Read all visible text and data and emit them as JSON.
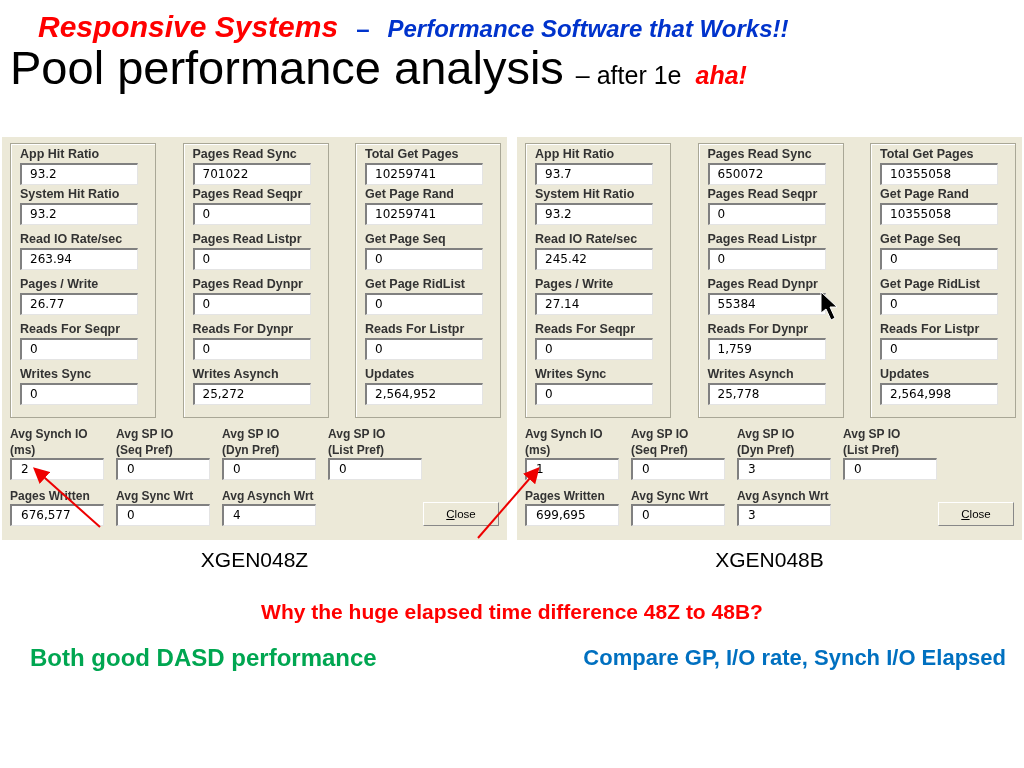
{
  "header": {
    "brand": "Responsive Systems",
    "dash": "–",
    "tagline": "Performance Software that Works!!"
  },
  "title": {
    "main": "Pool performance analysis",
    "suffix": "– after 1e",
    "exclaim": "aha!"
  },
  "panels": [
    {
      "caption": "XGEN048Z",
      "groups": [
        [
          {
            "label": "App Hit Ratio",
            "value": "93.2"
          },
          {
            "label": "System Hit Ratio",
            "value": "93.2"
          },
          {
            "label": "Read IO Rate/sec",
            "value": "263.94"
          },
          {
            "label": "Pages / Write",
            "value": "26.77"
          },
          {
            "label": "Reads For Seqpr",
            "value": "0"
          },
          {
            "label": "Writes Sync",
            "value": "0"
          }
        ],
        [
          {
            "label": "Pages Read Sync",
            "value": "701022"
          },
          {
            "label": "Pages Read Seqpr",
            "value": "0"
          },
          {
            "label": "Pages Read Listpr",
            "value": "0"
          },
          {
            "label": "Pages Read Dynpr",
            "value": "0"
          },
          {
            "label": "Reads For Dynpr",
            "value": "0"
          },
          {
            "label": "Writes Asynch",
            "value": "25,272"
          }
        ],
        [
          {
            "label": "Total Get Pages",
            "value": "10259741"
          },
          {
            "label": "Get Page Rand",
            "value": "10259741"
          },
          {
            "label": "Get Page Seq",
            "value": "0"
          },
          {
            "label": "Get Page RidList",
            "value": "0"
          },
          {
            "label": "Reads For Listpr",
            "value": "0"
          },
          {
            "label": "Updates",
            "value": "2,564,952"
          }
        ]
      ],
      "avg_row": [
        {
          "label": "Avg Synch IO\n(ms)",
          "value": "2"
        },
        {
          "label": "Avg SP IO\n(Seq Pref)",
          "value": "0"
        },
        {
          "label": "Avg SP IO\n(Dyn Pref)",
          "value": "0"
        },
        {
          "label": "Avg SP IO\n(List Pref)",
          "value": "0"
        }
      ],
      "bottom_row": [
        {
          "label": "Pages Written",
          "value": "676,577"
        },
        {
          "label": "Avg Sync Wrt",
          "value": "0"
        },
        {
          "label": "Avg Asynch Wrt",
          "value": "4"
        }
      ],
      "close": "Close"
    },
    {
      "caption": "XGEN048B",
      "groups": [
        [
          {
            "label": "App Hit Ratio",
            "value": "93.7"
          },
          {
            "label": "System Hit Ratio",
            "value": "93.2"
          },
          {
            "label": "Read IO Rate/sec",
            "value": "245.42"
          },
          {
            "label": "Pages / Write",
            "value": "27.14"
          },
          {
            "label": "Reads For Seqpr",
            "value": "0"
          },
          {
            "label": "Writes Sync",
            "value": "0"
          }
        ],
        [
          {
            "label": "Pages Read Sync",
            "value": "650072"
          },
          {
            "label": "Pages Read Seqpr",
            "value": "0"
          },
          {
            "label": "Pages Read Listpr",
            "value": "0"
          },
          {
            "label": "Pages Read Dynpr",
            "value": "55384"
          },
          {
            "label": "Reads For Dynpr",
            "value": "1,759"
          },
          {
            "label": "Writes Asynch",
            "value": "25,778"
          }
        ],
        [
          {
            "label": "Total Get Pages",
            "value": "10355058"
          },
          {
            "label": "Get Page Rand",
            "value": "10355058"
          },
          {
            "label": "Get Page Seq",
            "value": "0"
          },
          {
            "label": "Get Page RidList",
            "value": "0"
          },
          {
            "label": "Reads For Listpr",
            "value": "0"
          },
          {
            "label": "Updates",
            "value": "2,564,998"
          }
        ]
      ],
      "avg_row": [
        {
          "label": "Avg Synch IO\n(ms)",
          "value": "1"
        },
        {
          "label": "Avg SP IO\n(Seq Pref)",
          "value": "0"
        },
        {
          "label": "Avg SP IO\n(Dyn Pref)",
          "value": "3"
        },
        {
          "label": "Avg SP IO\n(List Pref)",
          "value": "0"
        }
      ],
      "bottom_row": [
        {
          "label": "Pages Written",
          "value": "699,695"
        },
        {
          "label": "Avg Sync Wrt",
          "value": "0"
        },
        {
          "label": "Avg Asynch Wrt",
          "value": "3"
        }
      ],
      "close": "Close"
    }
  ],
  "question": "Why the huge elapsed time difference 48Z to 48B?",
  "notes": [
    {
      "text": "Both good DASD performance",
      "color": "#00a651"
    },
    {
      "text": "Compare GP, I/O rate, Synch I/O Elapsed",
      "color": "#0070c0"
    }
  ]
}
